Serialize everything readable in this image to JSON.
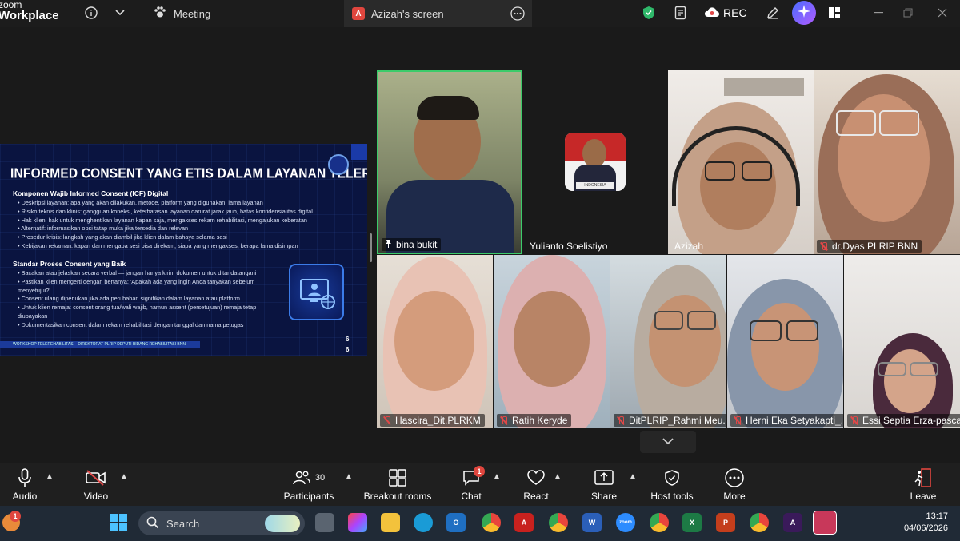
{
  "app": {
    "brand_line1": "zoom",
    "brand_line2": "Workplace"
  },
  "tabs": {
    "meeting": "Meeting",
    "screen_badge": "A",
    "screen": "Azizah's screen"
  },
  "topbar": {
    "rec_label": "REC"
  },
  "slide": {
    "title": "INFORMED CONSENT YANG ETIS DALAM LAYANAN TELEREHABILITASI",
    "section1": "Komponen Wajib Informed Consent (ICF) Digital",
    "bullets1": [
      "Deskripsi layanan: apa yang akan dilakukan, metode, platform yang digunakan, lama layanan",
      "Risiko teknis dan klinis: gangguan koneksi, keterbatasan layanan darurat jarak jauh, batas konfidensialitas digital",
      "Hak klien: hak untuk menghentikan layanan kapan saja, mengakses rekam rehabilitasi, mengajukan keberatan",
      "Alternatif: informasikan opsi tatap muka jika tersedia dan relevan",
      "Prosedur krisis: langkah yang akan diambil jika klien dalam bahaya selama sesi",
      "Kebijakan rekaman: kapan dan mengapa sesi bisa direkam, siapa yang mengakses, berapa lama disimpan"
    ],
    "section2": "Standar Proses Consent yang Baik",
    "bullets2": [
      "Bacakan atau jelaskan secara verbal — jangan hanya kirim dokumen untuk ditandatangani",
      "Pastikan klien mengerti dengan bertanya: 'Apakah ada yang ingin Anda tanyakan sebelum",
      "menyetujui?'",
      "Consent ulang diperlukan jika ada perubahan signifikan dalam layanan atau platform",
      "Untuk klien remaja: consent orang tua/wali wajib, namun assent (persetujuan) remaja tetap",
      "diupayakan",
      "Dokumentasikan consent dalam rekam rehabilitasi dengan tanggal dan nama petugas"
    ],
    "footer": "WORKSHOP TELEREHABILITASI - DIREKTORAT PLRIP DEPUTI BIDANG REHABILITASI BNN",
    "page_a": "6",
    "page_b": "6"
  },
  "participants": [
    {
      "name": "bina bukit"
    },
    {
      "name": "Yulianto Soelistiyo"
    },
    {
      "name": "Azizah"
    },
    {
      "name": "dr.Dyas PLRIP BNN"
    },
    {
      "name": "Hascira_Dit.PLRKM"
    },
    {
      "name": "Ratih Keryde"
    },
    {
      "name": "DitPLRIP_Rahmi Meu..."
    },
    {
      "name": "Herni Eka Setyakapti_..."
    },
    {
      "name": "Essi Septia Erza-pasca"
    }
  ],
  "yulianto_flag_text": "INDONESIA",
  "toolbar": {
    "audio": "Audio",
    "video": "Video",
    "participants": "Participants",
    "participants_count": "30",
    "breakout": "Breakout rooms",
    "chat": "Chat",
    "chat_badge": "1",
    "react": "React",
    "share": "Share",
    "host_tools": "Host tools",
    "more": "More",
    "leave": "Leave"
  },
  "taskbar": {
    "search_placeholder": "Search",
    "notif_count": "1",
    "time": "13:17",
    "date": "04/06/2026"
  },
  "colors": {
    "active_speaker_border": "#3ccb6a",
    "muted_red": "#e04848",
    "leave_red": "#e0463e",
    "slide_bg": "#0a1440"
  }
}
